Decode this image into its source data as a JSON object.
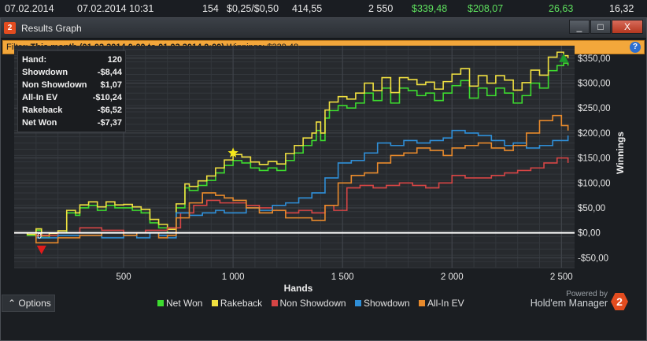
{
  "background_row": {
    "date": "07.02.2014",
    "datetime": "07.02.2014 10:31",
    "hands": "154",
    "stakes": "$0,25/$0,50",
    "col5": "414,55",
    "col6": "2 550",
    "col7": "$339,48",
    "col8": "$208,07",
    "col9": "26,63",
    "col10": "16,32"
  },
  "window": {
    "title": "Results Graph",
    "icon_text": "2",
    "buttons": [
      "_",
      "□",
      "X"
    ]
  },
  "filter": {
    "label": "Filter:",
    "value": "This month (01.02.2014 0:00 to 01.03.2014 0:00)",
    "winnings": "Winnings: $339,48",
    "help": "?"
  },
  "stats": [
    {
      "key": "Hand:",
      "value": "120"
    },
    {
      "key": "Showdown",
      "value": "-$8,44"
    },
    {
      "key": "Non Showdown",
      "value": "$1,07"
    },
    {
      "key": "All-In EV",
      "value": "-$10,24"
    },
    {
      "key": "Rakeback",
      "value": "-$6,52"
    },
    {
      "key": "Net Won",
      "value": "-$7,37"
    }
  ],
  "legend": [
    {
      "label": "Net Won",
      "color": "#3ddb2f"
    },
    {
      "label": "Rakeback",
      "color": "#f0e040"
    },
    {
      "label": "Non Showdown",
      "color": "#d64545"
    },
    {
      "label": "Showdown",
      "color": "#2f8fd8"
    },
    {
      "label": "All-In EV",
      "color": "#e88a2c"
    }
  ],
  "options_label": "Options",
  "branding": {
    "powered_by": "Powered by",
    "product": "Hold'em Manager",
    "logo_text": "2"
  },
  "chart_data": {
    "type": "line",
    "xlabel": "Hands",
    "ylabel": "Winnings",
    "xlim": [
      0,
      2560
    ],
    "ylim": [
      -70,
      375
    ],
    "x_ticks": [
      500,
      1000,
      1500,
      2000,
      2500
    ],
    "x_tick_labels": [
      "500",
      "1 000",
      "1 500",
      "2 000",
      "2 500"
    ],
    "y_ticks": [
      -50,
      0,
      50,
      100,
      150,
      200,
      250,
      300,
      350
    ],
    "y_tick_labels": [
      "-$50,00",
      "$0,00",
      "$50,00",
      "$100,00",
      "$150,00",
      "$200,00",
      "$250,00",
      "$300,00",
      "$350,00"
    ],
    "grid": true,
    "markers": {
      "low": {
        "x": 125,
        "y": -35,
        "color": "#e01b1b"
      },
      "high_star": {
        "x": 1000,
        "y": 160,
        "color": "#f5e81a"
      },
      "end": {
        "x": 2510,
        "y": 350,
        "color": "#1c9c2c"
      },
      "zero_label": {
        "x": 105,
        "y": -5,
        "text": "0"
      }
    },
    "series": [
      {
        "name": "Net Won",
        "color": "#3ddb2f",
        "x": [
          0,
          60,
          100,
          125,
          160,
          200,
          240,
          280,
          300,
          340,
          380,
          420,
          460,
          500,
          540,
          580,
          620,
          660,
          700,
          740,
          780,
          800,
          840,
          880,
          920,
          960,
          1000,
          1040,
          1080,
          1120,
          1160,
          1200,
          1240,
          1280,
          1320,
          1360,
          1380,
          1400,
          1420,
          1440,
          1480,
          1520,
          1560,
          1600,
          1640,
          1680,
          1720,
          1760,
          1800,
          1840,
          1880,
          1920,
          1960,
          2000,
          2040,
          2080,
          2120,
          2160,
          2200,
          2240,
          2280,
          2320,
          2360,
          2400,
          2440,
          2480,
          2510,
          2530
        ],
        "y": [
          0,
          -5,
          5,
          -10,
          -5,
          0,
          40,
          35,
          50,
          55,
          45,
          55,
          50,
          50,
          45,
          40,
          20,
          10,
          0,
          50,
          90,
          85,
          95,
          105,
          120,
          135,
          145,
          140,
          130,
          125,
          130,
          125,
          145,
          160,
          175,
          185,
          205,
          185,
          230,
          245,
          255,
          250,
          260,
          280,
          265,
          290,
          260,
          290,
          285,
          275,
          280,
          265,
          280,
          295,
          305,
          270,
          290,
          275,
          290,
          280,
          260,
          275,
          300,
          290,
          325,
          335,
          340,
          335
        ]
      },
      {
        "name": "Rakeback",
        "color": "#f0e040",
        "x": [
          0,
          60,
          100,
          125,
          160,
          200,
          240,
          280,
          300,
          340,
          380,
          420,
          460,
          500,
          540,
          580,
          620,
          660,
          700,
          740,
          780,
          800,
          840,
          880,
          920,
          960,
          1000,
          1040,
          1080,
          1120,
          1160,
          1200,
          1240,
          1280,
          1320,
          1360,
          1380,
          1400,
          1420,
          1440,
          1480,
          1520,
          1560,
          1600,
          1640,
          1680,
          1720,
          1760,
          1800,
          1840,
          1880,
          1920,
          1960,
          2000,
          2040,
          2080,
          2120,
          2160,
          2200,
          2240,
          2280,
          2320,
          2360,
          2400,
          2440,
          2480,
          2510,
          2530
        ],
        "y": [
          0,
          -3,
          8,
          -6,
          -1,
          4,
          45,
          40,
          56,
          62,
          52,
          62,
          56,
          57,
          52,
          47,
          27,
          17,
          7,
          58,
          98,
          93,
          104,
          114,
          130,
          146,
          157,
          152,
          142,
          137,
          143,
          138,
          159,
          175,
          190,
          200,
          222,
          200,
          246,
          262,
          273,
          268,
          280,
          300,
          285,
          311,
          281,
          311,
          307,
          297,
          302,
          288,
          303,
          318,
          329,
          294,
          315,
          300,
          315,
          306,
          286,
          301,
          326,
          316,
          352,
          362,
          355,
          350
        ]
      },
      {
        "name": "Non Showdown",
        "color": "#d64545",
        "x": [
          0,
          100,
          200,
          300,
          400,
          500,
          600,
          700,
          760,
          820,
          880,
          940,
          1000,
          1060,
          1120,
          1180,
          1240,
          1300,
          1360,
          1420,
          1460,
          1520,
          1580,
          1640,
          1700,
          1760,
          1820,
          1880,
          1940,
          2000,
          2060,
          2120,
          2180,
          2240,
          2300,
          2360,
          2420,
          2480,
          2530
        ],
        "y": [
          0,
          -5,
          0,
          10,
          5,
          0,
          5,
          10,
          40,
          55,
          65,
          60,
          60,
          55,
          50,
          45,
          40,
          45,
          40,
          55,
          45,
          90,
          95,
          90,
          95,
          100,
          95,
          90,
          100,
          115,
          110,
          110,
          115,
          120,
          125,
          130,
          140,
          150,
          140
        ]
      },
      {
        "name": "Showdown",
        "color": "#2f8fd8",
        "x": [
          0,
          100,
          200,
          300,
          400,
          500,
          560,
          620,
          660,
          700,
          740,
          800,
          860,
          920,
          960,
          1000,
          1060,
          1120,
          1180,
          1240,
          1300,
          1360,
          1420,
          1480,
          1540,
          1600,
          1660,
          1720,
          1780,
          1840,
          1900,
          1960,
          2000,
          2060,
          2120,
          2180,
          2240,
          2280,
          2340,
          2400,
          2460,
          2530
        ],
        "y": [
          0,
          -10,
          -5,
          -5,
          -10,
          -5,
          -10,
          0,
          -5,
          -10,
          40,
          35,
          40,
          45,
          40,
          40,
          50,
          45,
          55,
          60,
          70,
          80,
          110,
          140,
          145,
          160,
          180,
          175,
          185,
          180,
          185,
          190,
          205,
          200,
          195,
          185,
          175,
          180,
          170,
          175,
          185,
          195
        ]
      },
      {
        "name": "All-In EV",
        "color": "#e88a2c",
        "x": [
          0,
          100,
          200,
          300,
          400,
          500,
          560,
          620,
          660,
          700,
          740,
          800,
          860,
          920,
          960,
          1000,
          1060,
          1120,
          1180,
          1240,
          1300,
          1360,
          1420,
          1480,
          1540,
          1600,
          1660,
          1720,
          1780,
          1840,
          1900,
          1960,
          2000,
          2060,
          2120,
          2180,
          2240,
          2280,
          2340,
          2400,
          2460,
          2500,
          2530
        ],
        "y": [
          0,
          -20,
          -10,
          -5,
          0,
          -5,
          0,
          0,
          -10,
          -5,
          30,
          60,
          80,
          75,
          70,
          65,
          50,
          40,
          45,
          30,
          30,
          25,
          55,
          100,
          115,
          120,
          140,
          155,
          160,
          170,
          165,
          155,
          170,
          175,
          180,
          170,
          165,
          175,
          200,
          225,
          235,
          215,
          205
        ]
      }
    ]
  }
}
